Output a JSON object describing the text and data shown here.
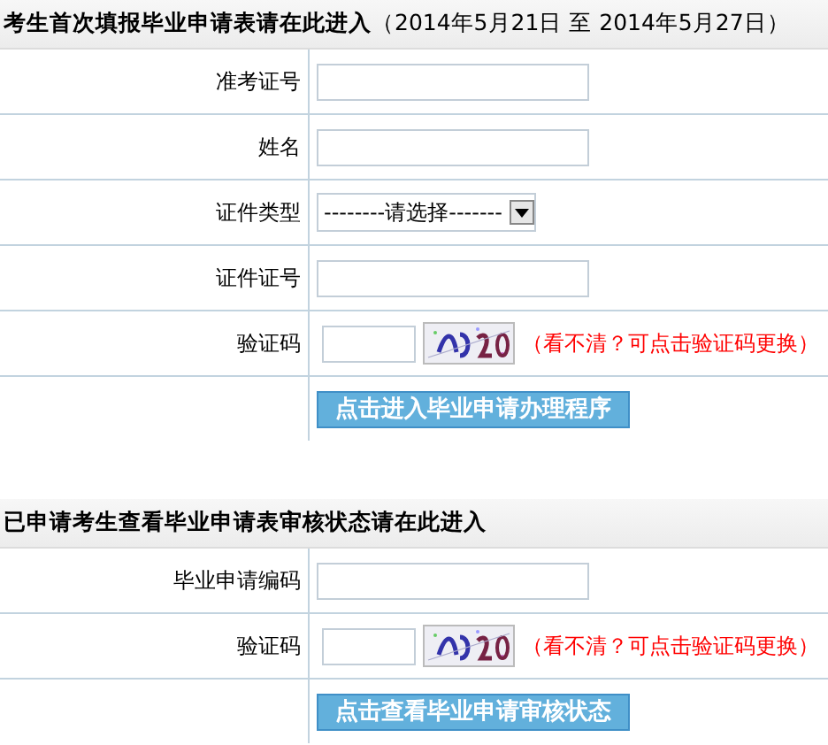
{
  "sections": [
    {
      "title": "**考生首次填报毕业申请表请在此进入**（2014年5月21日 至 2014年5月27日）",
      "rows": [
        {
          "kind": "text",
          "label": "准考证号"
        },
        {
          "kind": "text",
          "label": "姓名"
        },
        {
          "kind": "select",
          "label": "证件类型",
          "value": "--------请选择-------"
        },
        {
          "kind": "text",
          "label": "证件证号"
        },
        {
          "kind": "captcha",
          "label": "验证码",
          "hint": "（看不清？可点击验证码更换）"
        }
      ],
      "button": "点击进入毕业申请办理程序"
    },
    {
      "title": "**已申请考生查看毕业申请表审核状态请在此进入**",
      "rows": [
        {
          "kind": "text",
          "label": "毕业申请编码"
        },
        {
          "kind": "captcha",
          "label": "验证码",
          "hint": "（看不清？可点击验证码更换）"
        }
      ],
      "button": "点击查看毕业申请审核状态"
    }
  ]
}
